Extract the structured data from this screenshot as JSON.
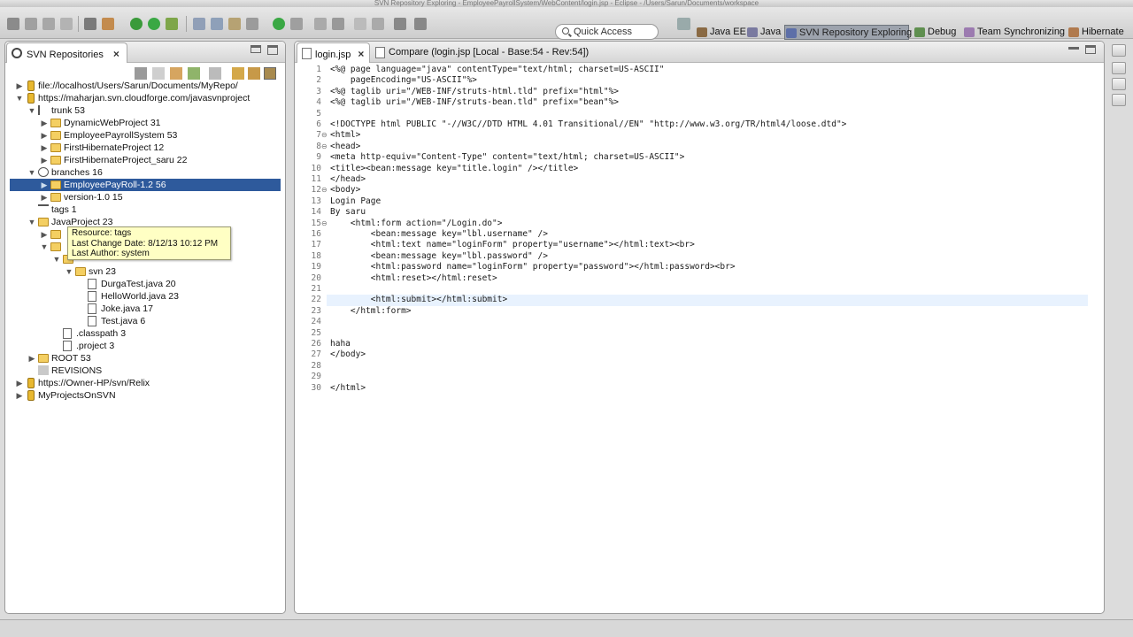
{
  "window": {
    "title": "SVN Repository Exploring - EmployeePayrollSystem/WebContent/login.jsp - Eclipse - /Users/Sarun/Documents/workspace"
  },
  "toolbar": {
    "quick_access": "Quick Access",
    "perspectives": [
      {
        "label": "Java EE",
        "icon": "java-ee-icon"
      },
      {
        "label": "Java",
        "icon": "java-icon"
      },
      {
        "label": "SVN Repository Exploring",
        "icon": "svn-icon",
        "active": true
      },
      {
        "label": "Debug",
        "icon": "debug-icon"
      },
      {
        "label": "Team Synchronizing",
        "icon": "team-sync-icon"
      },
      {
        "label": "Hibernate",
        "icon": "hibernate-icon"
      }
    ]
  },
  "left": {
    "tab_title": "SVN Repositories",
    "close": "×",
    "tree": [
      {
        "label": "file://localhost/Users/Sarun/Documents/MyRepo/",
        "indent": 0,
        "arrow": "▶",
        "icon": "repo"
      },
      {
        "label": "https://maharjan.svn.cloudforge.com/javasvnproject",
        "indent": 0,
        "arrow": "▼",
        "icon": "repo"
      },
      {
        "label": "trunk 53",
        "indent": 1,
        "arrow": "▼",
        "icon": "trunk"
      },
      {
        "label": "DynamicWebProject 31",
        "indent": 2,
        "arrow": "▶",
        "icon": "folder"
      },
      {
        "label": "EmployeePayrollSystem 53",
        "indent": 2,
        "arrow": "▶",
        "icon": "folder"
      },
      {
        "label": "FirstHibernateProject 12",
        "indent": 2,
        "arrow": "▶",
        "icon": "folder"
      },
      {
        "label": "FirstHibernateProject_saru 22",
        "indent": 2,
        "arrow": "▶",
        "icon": "folder"
      },
      {
        "label": "branches 16",
        "indent": 1,
        "arrow": "▼",
        "icon": "branches"
      },
      {
        "label": "EmployeePayRoll-1.2 56",
        "indent": 2,
        "arrow": "▶",
        "icon": "folder",
        "selected": true
      },
      {
        "label": "version-1.0 15",
        "indent": 2,
        "arrow": "▶",
        "icon": "folder"
      },
      {
        "label": "tags 1",
        "indent": 1,
        "arrow": "",
        "icon": "tags"
      },
      {
        "label": "JavaProject 23",
        "indent": 1,
        "arrow": "▼",
        "icon": "folder"
      },
      {
        "label": "",
        "indent": 2,
        "arrow": "▶",
        "icon": "folder"
      },
      {
        "label": "",
        "indent": 2,
        "arrow": "▼",
        "icon": "folder"
      },
      {
        "label": "",
        "indent": 3,
        "arrow": "▼",
        "icon": "folder"
      },
      {
        "label": "svn 23",
        "indent": 4,
        "arrow": "▼",
        "icon": "folder"
      },
      {
        "label": "DurgaTest.java 20",
        "indent": 5,
        "arrow": "",
        "icon": "file"
      },
      {
        "label": "HelloWorld.java 23",
        "indent": 5,
        "arrow": "",
        "icon": "file"
      },
      {
        "label": "Joke.java 17",
        "indent": 5,
        "arrow": "",
        "icon": "file"
      },
      {
        "label": "Test.java 6",
        "indent": 5,
        "arrow": "",
        "icon": "file"
      },
      {
        "label": ".classpath 3",
        "indent": 3,
        "arrow": "",
        "icon": "file"
      },
      {
        "label": ".project 3",
        "indent": 3,
        "arrow": "",
        "icon": "file"
      },
      {
        "label": "ROOT 53",
        "indent": 1,
        "arrow": "▶",
        "icon": "folder"
      },
      {
        "label": "REVISIONS",
        "indent": 1,
        "arrow": "",
        "icon": "revisions"
      },
      {
        "label": "https://Owner-HP/svn/Relix",
        "indent": 0,
        "arrow": "▶",
        "icon": "repo"
      },
      {
        "label": "MyProjectsOnSVN",
        "indent": 0,
        "arrow": "▶",
        "icon": "repo"
      }
    ],
    "tooltip": {
      "resource": "Resource: tags",
      "date": "Last Change Date: 8/12/13 10:12 PM",
      "author": "Last Author: system"
    }
  },
  "editor": {
    "tabs": [
      {
        "label": "login.jsp",
        "close": "×",
        "active": true
      },
      {
        "label": "Compare (login.jsp [Local - Base:54 - Rev:54])",
        "active": false
      }
    ],
    "current_line": 22,
    "lines": [
      {
        "n": "1",
        "fold": "",
        "text": "<%@ page language=\"java\" contentType=\"text/html; charset=US-ASCII\""
      },
      {
        "n": "2",
        "fold": "",
        "text": "    pageEncoding=\"US-ASCII\"%>"
      },
      {
        "n": "3",
        "fold": "",
        "text": "<%@ taglib uri=\"/WEB-INF/struts-html.tld\" prefix=\"html\"%>"
      },
      {
        "n": "4",
        "fold": "",
        "text": "<%@ taglib uri=\"/WEB-INF/struts-bean.tld\" prefix=\"bean\"%>"
      },
      {
        "n": "5",
        "fold": "",
        "text": ""
      },
      {
        "n": "6",
        "fold": "",
        "text": "<!DOCTYPE html PUBLIC \"-//W3C//DTD HTML 4.01 Transitional//EN\" \"http://www.w3.org/TR/html4/loose.dtd\">"
      },
      {
        "n": "7",
        "fold": "⊖",
        "text": "<html>"
      },
      {
        "n": "8",
        "fold": "⊖",
        "text": "<head>"
      },
      {
        "n": "9",
        "fold": "",
        "text": "<meta http-equiv=\"Content-Type\" content=\"text/html; charset=US-ASCII\">"
      },
      {
        "n": "10",
        "fold": "",
        "text": "<title><bean:message key=\"title.login\" /></title>"
      },
      {
        "n": "11",
        "fold": "",
        "text": "</head>"
      },
      {
        "n": "12",
        "fold": "⊖",
        "text": "<body>"
      },
      {
        "n": "13",
        "fold": "",
        "text": "Login Page"
      },
      {
        "n": "14",
        "fold": "",
        "text": "By saru"
      },
      {
        "n": "15",
        "fold": "⊖",
        "text": "    <html:form action=\"/Login.do\">"
      },
      {
        "n": "16",
        "fold": "",
        "text": "        <bean:message key=\"lbl.username\" />"
      },
      {
        "n": "17",
        "fold": "",
        "text": "        <html:text name=\"loginForm\" property=\"username\"></html:text><br>"
      },
      {
        "n": "18",
        "fold": "",
        "text": "        <bean:message key=\"lbl.password\" />"
      },
      {
        "n": "19",
        "fold": "",
        "text": "        <html:password name=\"loginForm\" property=\"password\"></html:password><br>"
      },
      {
        "n": "20",
        "fold": "",
        "text": "        <html:reset></html:reset>"
      },
      {
        "n": "21",
        "fold": "",
        "text": ""
      },
      {
        "n": "22",
        "fold": "",
        "text": "        <html:submit></html:submit>"
      },
      {
        "n": "23",
        "fold": "",
        "text": "    </html:form>"
      },
      {
        "n": "24",
        "fold": "",
        "text": ""
      },
      {
        "n": "25",
        "fold": "",
        "text": ""
      },
      {
        "n": "26",
        "fold": "",
        "text": "haha"
      },
      {
        "n": "27",
        "fold": "",
        "text": "</body>"
      },
      {
        "n": "28",
        "fold": "",
        "text": ""
      },
      {
        "n": "29",
        "fold": "",
        "text": ""
      },
      {
        "n": "30",
        "fold": "",
        "text": "</html>"
      }
    ]
  },
  "colors": {
    "selection": "#2e5a9c",
    "current_line": "#e8f2fe",
    "tooltip_bg": "#ffffc4",
    "accent": "#2e5a9c"
  }
}
